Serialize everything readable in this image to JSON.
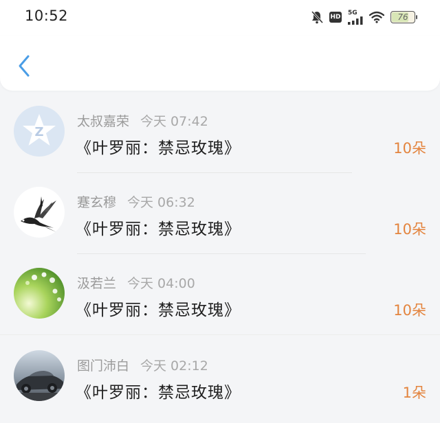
{
  "status_bar": {
    "time": "10:52",
    "network": "5G",
    "hd": "HD",
    "battery": "76",
    "battery_fraction": 0.76,
    "icons": [
      "bell-muted-icon",
      "hd-icon",
      "signal-icon",
      "wifi-icon",
      "battery-icon"
    ]
  },
  "nav": {
    "back_icon": "chevron-left-icon",
    "accent_color": "#4a9de6"
  },
  "gifts": [
    {
      "name": "太叔嘉荣",
      "time": "今天 07:42",
      "title": "《叶罗丽：禁忌玫瑰》",
      "count": "10朵",
      "avatar": "qq-default-avatar"
    },
    {
      "name": "蹇玄穆",
      "time": "今天 06:32",
      "title": "《叶罗丽：禁忌玫瑰》",
      "count": "10朵",
      "avatar": "swallow-avatar"
    },
    {
      "name": "汲若兰",
      "time": "今天 04:00",
      "title": "《叶罗丽：禁忌玫瑰》",
      "count": "10朵",
      "avatar": "green-flowers-avatar"
    },
    {
      "name": "图门沛白",
      "time": "今天 02:12",
      "title": "《叶罗丽：禁忌玫瑰》",
      "count": "1朵",
      "avatar": "car-avatar"
    }
  ],
  "colors": {
    "count_orange": "#e3843e",
    "meta_gray": "#9a9a9a",
    "title_black": "#1f1f1f",
    "background": "#f4f5f7"
  }
}
